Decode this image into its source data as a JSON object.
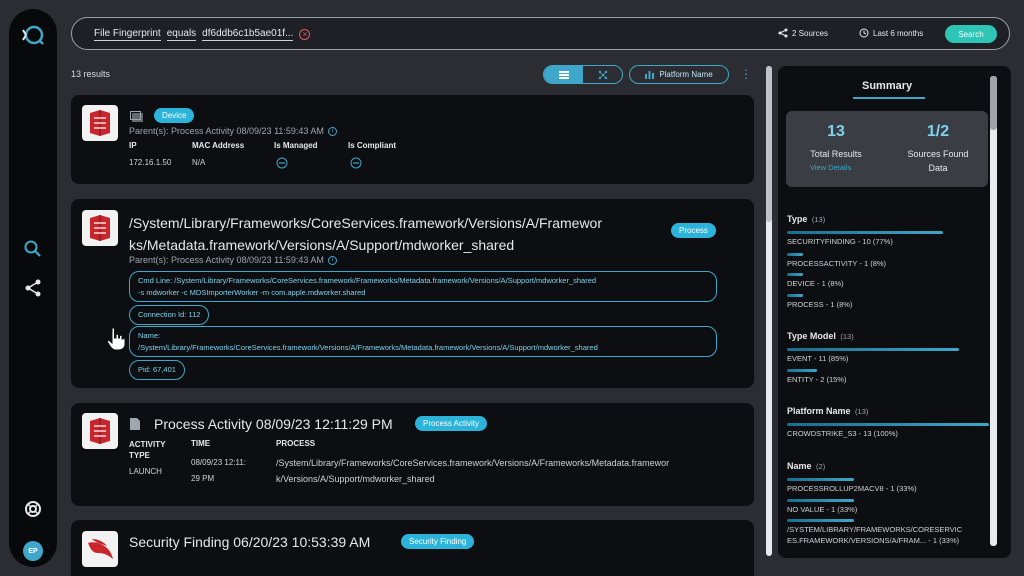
{
  "nav": {
    "avatar_initials": "EP"
  },
  "topbar": {
    "query_field": "File Fingerprint",
    "query_operator": "equals",
    "query_value": "df6ddb6c1b5ae01f...",
    "sources_label": "2 Sources",
    "time_range_label": "Last 6 months",
    "search_label": "Search"
  },
  "results": {
    "count_label": "13 results",
    "platform_button_label": "Platform Name"
  },
  "cards": {
    "device": {
      "badge": "Device",
      "parent": "Parent(s): Process Activity 08/09/23 11:59:43 AM",
      "columns": [
        {
          "label": "IP",
          "value": "172.16.1.50"
        },
        {
          "label": "MAC Address",
          "value": "N/A"
        },
        {
          "label": "Is Managed",
          "value": ""
        },
        {
          "label": "Is Compliant",
          "value": ""
        }
      ]
    },
    "process": {
      "title_line1": "/System/Library/Frameworks/CoreServices.framework/Versions/A/Framewor",
      "title_line2": "ks/Metadata.framework/Versions/A/Support/mdworker_shared",
      "badge": "Process",
      "parent": "Parent(s): Process Activity 08/09/23 11:59:43 AM",
      "cmd_line_1": "Cmd Line: /System/Library/Frameworks/CoreServices.framework/Frameworks/Metadata.framework/Versions/A/Support/mdworker_shared",
      "cmd_line_2": "-s mdworker -c MDSImporterWorker -m com.apple.mdworker.shared",
      "connection_id": "Connection Id: 112",
      "name_label": "Name:",
      "name_value": "/System/Library/Frameworks/CoreServices.framework/Versions/A/Frameworks/Metadata.framework/Versions/A/Support/mdworker_shared",
      "pid": "Pid: 67,401"
    },
    "activity": {
      "title": "Process Activity 08/09/23 12:11:29 PM",
      "badge": "Process Activity",
      "col_activity_type_1": "ACTIVITY",
      "col_activity_type_2": "TYPE",
      "col_time": "TIME",
      "col_process": "PROCESS",
      "activity_type_value": "LAUNCH",
      "time_value_1": "08/09/23 12:11:",
      "time_value_2": "29 PM",
      "process_value_1": "/System/Library/Frameworks/CoreServices.framework/Versions/A/Frameworks/Metadata.framewor",
      "process_value_2": "k/Versions/A/Support/mdworker_shared"
    },
    "finding": {
      "title": "Security Finding 06/20/23 10:53:39 AM",
      "badge": "Security Finding"
    }
  },
  "summary": {
    "title": "Summary",
    "total_results_value": "13",
    "total_results_label": "Total Results",
    "view_details": "View Details",
    "sources_found_value": "1/2",
    "sources_found_label_1": "Sources Found",
    "sources_found_label_2": "Data",
    "facets": {
      "type": {
        "title": "Type",
        "count": "(13)",
        "items": [
          {
            "label": "SECURITYFINDING - 10 (77%)",
            "fraction": 0.77
          },
          {
            "label": "PROCESSACTIVITY - 1 (8%)",
            "fraction": 0.08
          },
          {
            "label": "DEVICE - 1 (8%)",
            "fraction": 0.08
          },
          {
            "label": "PROCESS - 1 (8%)",
            "fraction": 0.08
          }
        ]
      },
      "type_model": {
        "title": "Type Model",
        "count": "(13)",
        "items": [
          {
            "label": "EVENT - 11 (85%)",
            "fraction": 0.85
          },
          {
            "label": "ENTITY - 2 (15%)",
            "fraction": 0.15
          }
        ]
      },
      "platform_name": {
        "title": "Platform Name",
        "count": "(13)",
        "items": [
          {
            "label": "CROWDSTRIKE_S3 - 13 (100%)",
            "fraction": 1.0
          }
        ]
      },
      "name": {
        "title": "Name",
        "count": "(2)",
        "items": [
          {
            "label": "PROCESSROLLUP2MACV8 - 1 (33%)",
            "fraction": 0.33
          },
          {
            "label": "NO VALUE - 1 (33%)",
            "fraction": 0.33
          },
          {
            "label": "/SYSTEM/LIBRARY/FRAMEWORKS/CORESERVIC",
            "fraction": 0.33
          },
          {
            "label": "ES.FRAMEWORK/VERSIONS/A/FRAM... - 1 (33%)",
            "fraction": 0
          }
        ]
      }
    }
  },
  "colors": {
    "accent": "#3fa7c9",
    "search_button": "#2ec4b6",
    "badge": "#2bb3d9",
    "crowdstrike_red": "#c8262c"
  }
}
